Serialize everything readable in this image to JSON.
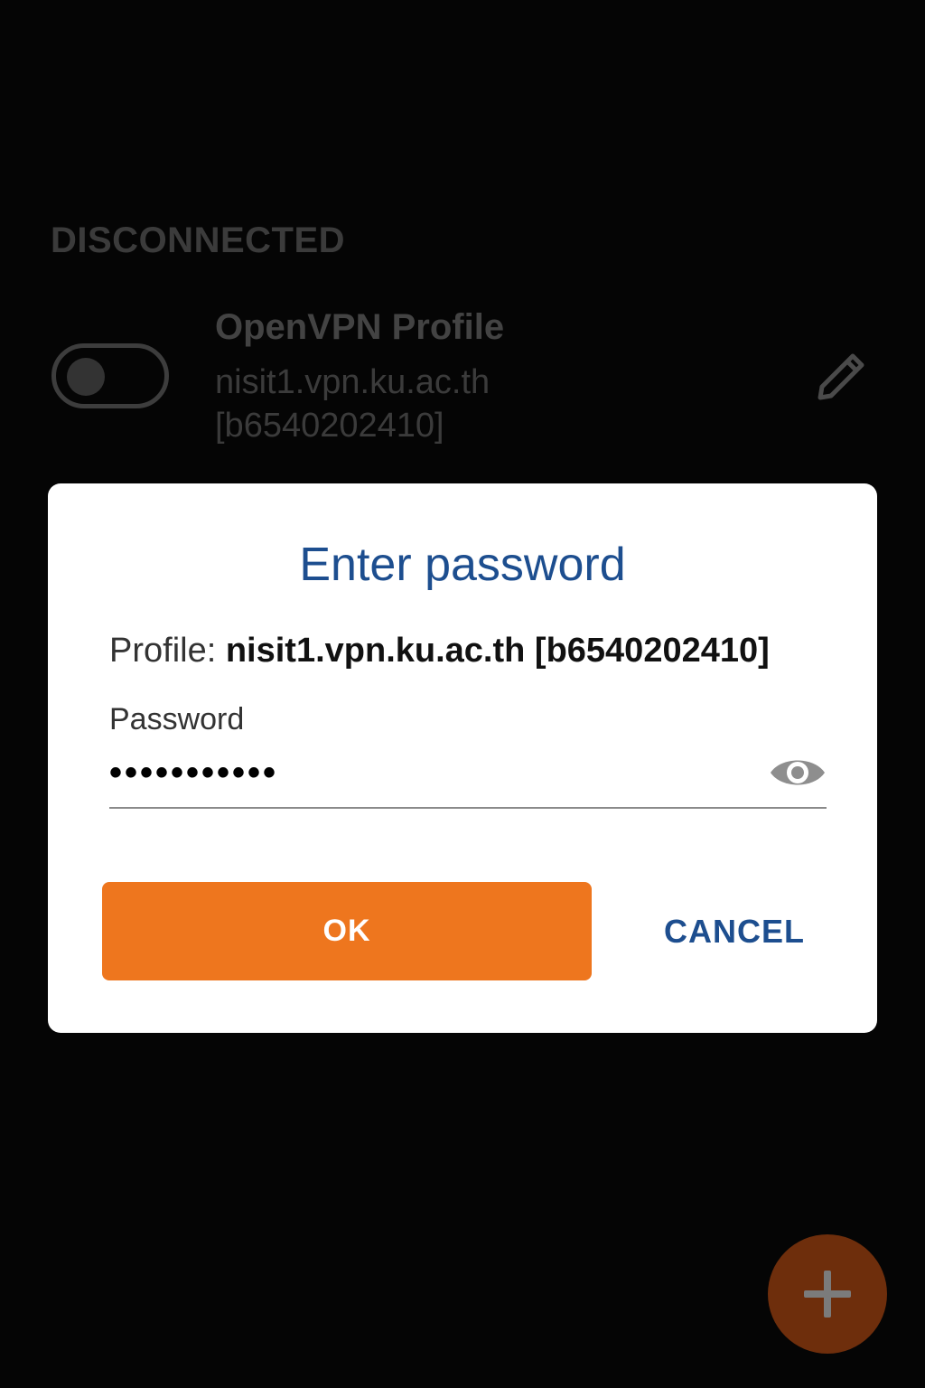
{
  "status": {
    "heading": "DISCONNECTED"
  },
  "profile": {
    "name": "OpenVPN Profile",
    "host": "nisit1.vpn.ku.ac.th",
    "user": "[b6540202410]",
    "toggle_on": false,
    "edit_icon": "pencil-icon"
  },
  "dialog": {
    "title": "Enter password",
    "profile_label": "Profile:",
    "profile_value": "nisit1.vpn.ku.ac.th [b6540202410]",
    "password_label": "Password",
    "password_value": "•••••••••••",
    "visibility_icon": "eye-icon",
    "ok_label": "OK",
    "cancel_label": "CANCEL"
  },
  "fab": {
    "icon": "plus-icon"
  },
  "colors": {
    "accent": "#ee761e",
    "title_blue": "#1d4e8f",
    "background": "#000000",
    "dialog": "#ffffff"
  }
}
